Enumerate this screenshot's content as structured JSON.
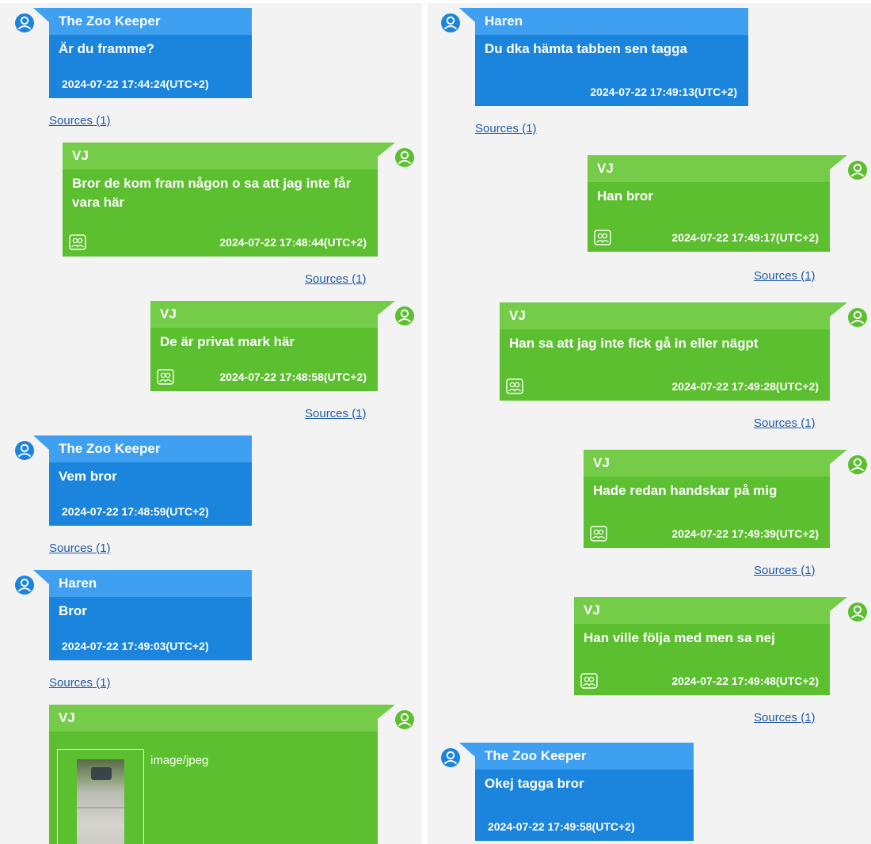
{
  "colors": {
    "incoming_bubble": "#1b84dc",
    "incoming_header": "#3f9ff0",
    "outgoing_bubble": "#5cbf2f",
    "outgoing_header": "#74cc48",
    "link": "#1f5aa8",
    "panel_background": "#f3f3f3"
  },
  "icons": {
    "avatar": "user-avatar-icon",
    "participants": "participants-icon"
  },
  "left_panel": {
    "messages": [
      {
        "sender": "The Zoo Keeper",
        "direction": "incoming",
        "text": "Är du framme?",
        "timestamp": "2024-07-22 17:44:24(UTC+2)",
        "sources": "Sources (1)"
      },
      {
        "sender": "VJ",
        "direction": "outgoing",
        "text": "Bror de kom fram någon o sa att jag inte får vara här",
        "timestamp": "2024-07-22 17:48:44(UTC+2)",
        "sources": "Sources (1)"
      },
      {
        "sender": "VJ",
        "direction": "outgoing",
        "text": "De är privat mark här",
        "timestamp": "2024-07-22 17:48:58(UTC+2)",
        "sources": "Sources (1)"
      },
      {
        "sender": "The Zoo Keeper",
        "direction": "incoming",
        "text": "Vem bror",
        "timestamp": "2024-07-22 17:48:59(UTC+2)",
        "sources": "Sources (1)"
      },
      {
        "sender": "Haren",
        "direction": "incoming",
        "text": "Bror",
        "timestamp": "2024-07-22 17:49:03(UTC+2)",
        "sources": "Sources (1)"
      },
      {
        "sender": "VJ",
        "direction": "outgoing",
        "attachment_type": "image/jpeg"
      }
    ]
  },
  "right_panel": {
    "messages": [
      {
        "sender": "Haren",
        "direction": "incoming",
        "text": "Du dka hämta tabben sen tagga",
        "timestamp": "2024-07-22 17:49:13(UTC+2)",
        "sources": "Sources (1)"
      },
      {
        "sender": "VJ",
        "direction": "outgoing",
        "text": "Han bror",
        "timestamp": "2024-07-22 17:49:17(UTC+2)",
        "sources": "Sources (1)"
      },
      {
        "sender": "VJ",
        "direction": "outgoing",
        "text": "Han sa att jag inte fick gå in eller nägpt",
        "timestamp": "2024-07-22 17:49:28(UTC+2)",
        "sources": "Sources (1)"
      },
      {
        "sender": "VJ",
        "direction": "outgoing",
        "text": "Hade redan handskar på mig",
        "timestamp": "2024-07-22 17:49:39(UTC+2)",
        "sources": "Sources (1)"
      },
      {
        "sender": "VJ",
        "direction": "outgoing",
        "text": "Han ville följa med men sa nej",
        "timestamp": "2024-07-22 17:49:48(UTC+2)",
        "sources": "Sources (1)"
      },
      {
        "sender": "The Zoo Keeper",
        "direction": "incoming",
        "text": "Okej tagga bror",
        "timestamp": "2024-07-22 17:49:58(UTC+2)"
      }
    ]
  }
}
